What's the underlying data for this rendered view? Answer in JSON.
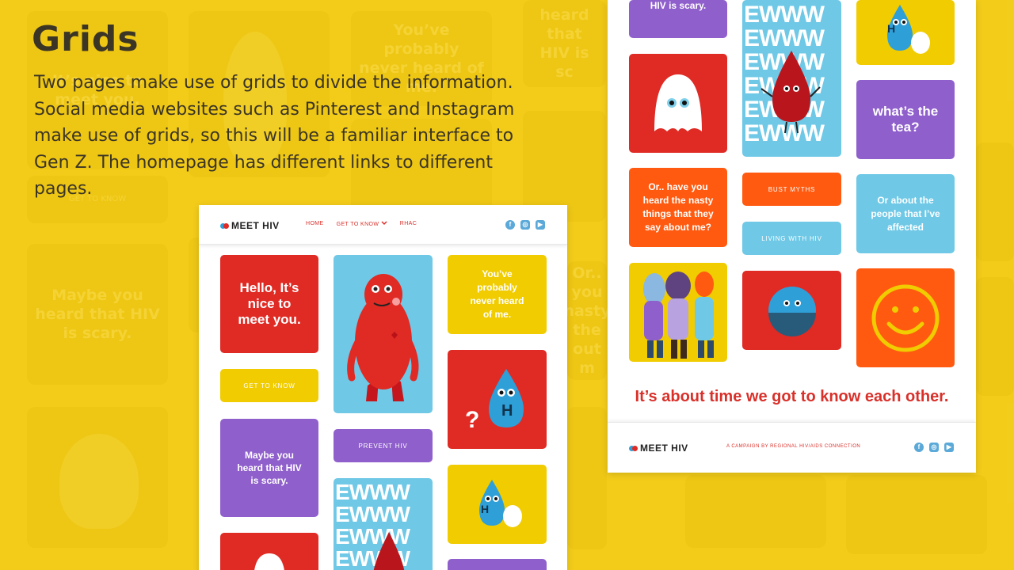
{
  "slide": {
    "title": "Grids",
    "description": "Two pages make use of grids to divide the information. Social media websites such as Pinterest and Instagram make use of grids, so this will be a familiar interface to Gen Z. The homepage has different links to different pages."
  },
  "background": {
    "tiles": [
      "It’s nice to meet you.",
      "You’ve probably never heard of me.",
      "heard that HIV is sc",
      "GET TO KNOW",
      "Maybe you heard that HIV is scary.",
      "Or.. you nasty the out m"
    ]
  },
  "page1": {
    "logo": "MEET HIV",
    "nav": [
      "HOME",
      "GET TO KNOW",
      "RHAC"
    ],
    "cards": {
      "hello": "Hello, It’s nice to meet you.",
      "get_to_know": "GET TO KNOW",
      "maybe": "Maybe you heard that HIV is scary.",
      "prevent": "PREVENT HIV",
      "never_heard": "You’ve probably never heard of me.",
      "ewww": "EWWW"
    },
    "question_mark": "?",
    "drop_letter": "H"
  },
  "page2": {
    "cards": {
      "scary": "HIV is scary.",
      "tea": "what’s the tea?",
      "nasty": "Or.. have you heard the nasty things that they say about me?",
      "bust": "BUST MYTHS",
      "living": "LIVING WITH HIV",
      "people": "Or about the people that I’ve affected",
      "ewww": "EWWW"
    },
    "tagline": "It’s about time we got to know each other.",
    "footer_logo": "MEET HIV",
    "footer_text": "A CAMPAIGN BY REGIONAL HIV/AIDS CONNECTION",
    "drop_letter": "H"
  },
  "colors": {
    "background": "#f3cd1b",
    "red": "#e02a24",
    "yellow": "#f0cc00",
    "purple": "#8f5fcc",
    "blue": "#6ec8e6",
    "orange": "#ff5a10",
    "text": "#3b3526"
  },
  "icons": [
    "facebook-icon",
    "instagram-icon",
    "youtube-icon",
    "chevron-down-icon"
  ]
}
